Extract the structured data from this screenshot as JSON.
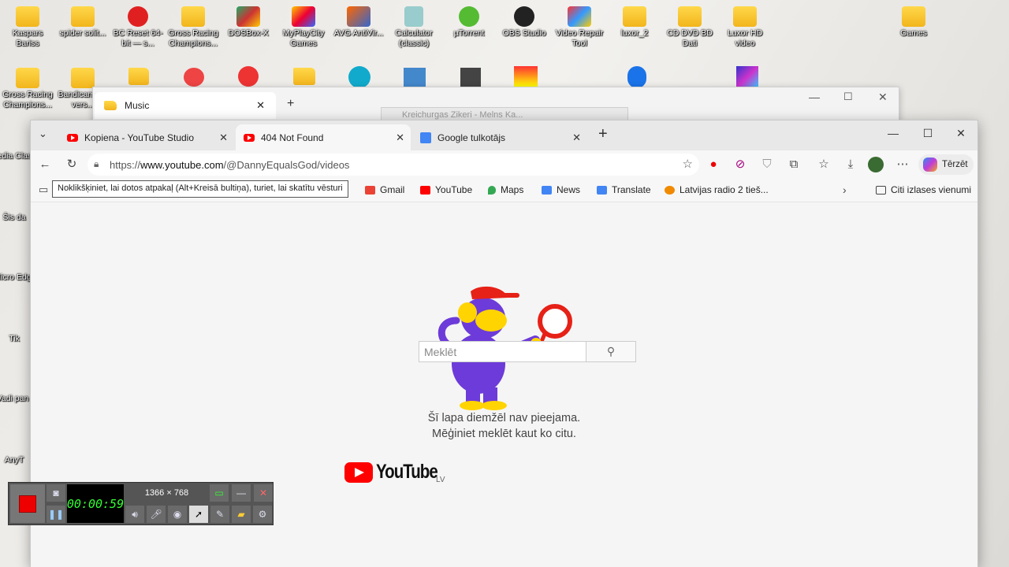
{
  "desktop": {
    "icons": [
      {
        "label": "Kaspars Bariss",
        "type": "folder"
      },
      {
        "label": "spider solit...",
        "type": "folder"
      },
      {
        "label": "BC Reset 64-bit — s...",
        "type": "app"
      },
      {
        "label": "Gross Racing Champions...",
        "type": "folder"
      },
      {
        "label": "DOSBox-X",
        "type": "app"
      },
      {
        "label": "MyPlayCity Games",
        "type": "app"
      },
      {
        "label": "AVG AntiVir...",
        "type": "app"
      },
      {
        "label": "Calculator (classic)",
        "type": "app"
      },
      {
        "label": "µTorrent",
        "type": "app"
      },
      {
        "label": "OBS Studio",
        "type": "app"
      },
      {
        "label": "Video Repair Tool",
        "type": "app"
      },
      {
        "label": "luxor_2",
        "type": "folder"
      },
      {
        "label": "CD DVD BD Dati",
        "type": "folder"
      },
      {
        "label": "Luxor HD video",
        "type": "folder"
      },
      {
        "label": "Games",
        "type": "folder"
      },
      {
        "label": "Gross Racing Champions...",
        "type": "folder"
      },
      {
        "label": "Bandicam full vers...",
        "type": "folder"
      }
    ],
    "side_labels": [
      "Media Clas",
      "Šis da",
      "Micro Edg",
      "Tik",
      "Vadi pan",
      "AnyT"
    ]
  },
  "music_window": {
    "tab_label": "Music",
    "new_tab": "+"
  },
  "mini_window": {
    "title": "Kreichurgas Zikeri - Melns Ka..."
  },
  "browser": {
    "tabs": [
      {
        "label": "Kopiena - YouTube Studio",
        "active": false
      },
      {
        "label": "404 Not Found",
        "active": true
      },
      {
        "label": "Google tulkotājs",
        "active": false
      }
    ],
    "new_tab": "+",
    "address_prefix": "https://",
    "address_host": "www.youtube.com",
    "address_path": "/@DannyEqualsGod/videos",
    "copilot_label": "Tērzēt",
    "tooltip": "Noklikšķiniet, lai dotos atpakaļ (Alt+Kreisā bultiņa), turiet, lai skatītu vēsturi",
    "bookmarks": [
      {
        "label": "Gmail",
        "color": "#ea4335"
      },
      {
        "label": "YouTube",
        "color": "#ff0000"
      },
      {
        "label": "Maps",
        "color": "#34a853"
      },
      {
        "label": "News",
        "color": "#4285f4"
      },
      {
        "label": "Translate",
        "color": "#4285f4"
      },
      {
        "label": "Latvijas radio 2 tieš...",
        "color": "#f08a00"
      }
    ],
    "other_bookmarks": "Citi izlases vienumi"
  },
  "page": {
    "error_line1": "Šī lapa diemžēl nav pieejama.",
    "error_line2": "Mēģiniet meklēt kaut ko citu.",
    "logo_word": "YouTube",
    "logo_country": "LV",
    "search_placeholder": "Meklēt"
  },
  "recorder": {
    "timer": "00:00:59",
    "resolution": "1366 × 768"
  }
}
